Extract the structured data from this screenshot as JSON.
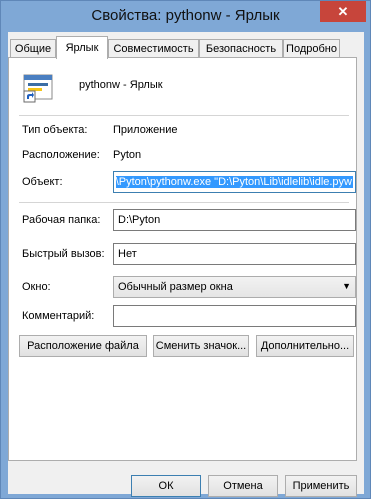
{
  "window": {
    "title": "Свойства: pythonw - Ярлык",
    "close_glyph": "✕"
  },
  "tabs": [
    {
      "label": "Общие"
    },
    {
      "label": "Ярлык"
    },
    {
      "label": "Совместимость"
    },
    {
      "label": "Безопасность"
    },
    {
      "label": "Подробно"
    }
  ],
  "shortcut": {
    "name": "pythonw - Ярлык",
    "type_label": "Тип объекта:",
    "type_value": "Приложение",
    "location_label": "Расположение:",
    "location_value": "Pyton",
    "target_label": "Объект:",
    "target_value": "D:\\Pyton\\pythonw.exe \"D:\\Pyton\\Lib\\idlelib\\idle.pyw\"",
    "workdir_label": "Рабочая папка:",
    "workdir_value": "D:\\Pyton",
    "hotkey_label": "Быстрый вызов:",
    "hotkey_value": "Нет",
    "window_label": "Окно:",
    "window_value": "Обычный размер окна",
    "comment_label": "Комментарий:",
    "comment_value": ""
  },
  "buttons": {
    "open_location": "Расположение файла",
    "change_icon": "Сменить значок...",
    "advanced": "Дополнительно...",
    "ok": "ОК",
    "cancel": "Отмена",
    "apply": "Применить"
  },
  "icons": {
    "app": "python-app-icon",
    "shortcut_arrow": "shortcut-arrow-icon",
    "dropdown": "chevron-down-icon"
  }
}
